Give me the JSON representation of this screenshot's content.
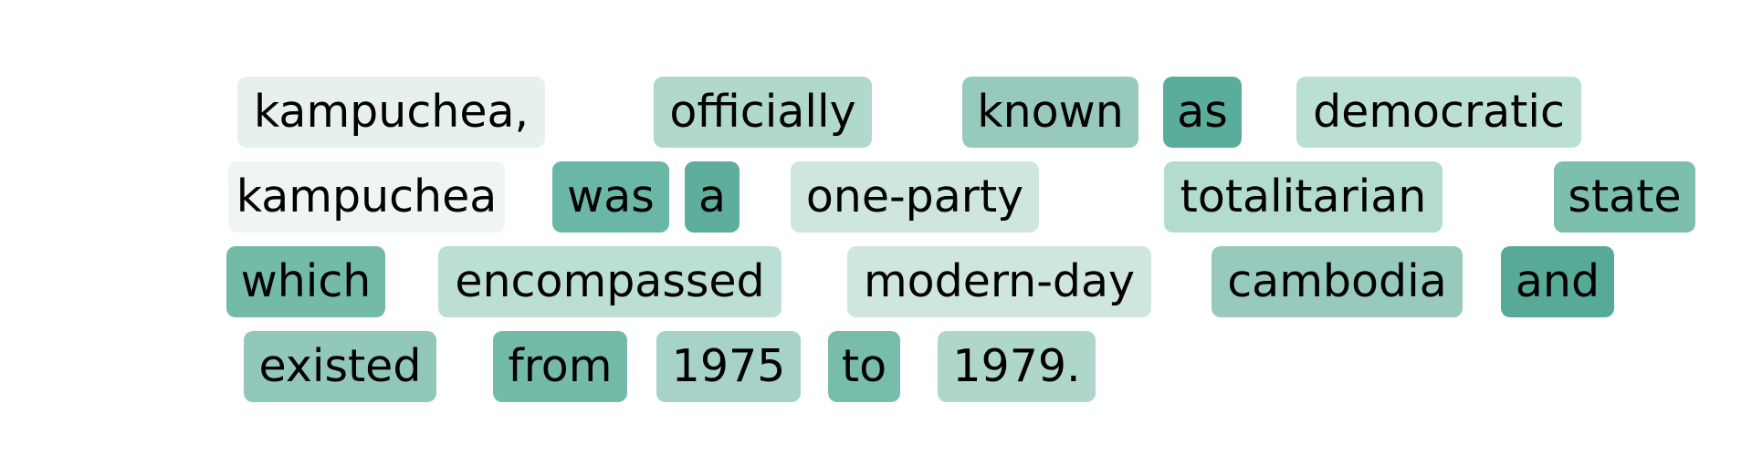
{
  "tokens": [
    {
      "text": "kampuchea,",
      "color": "#e6f0ed",
      "line": 0
    },
    {
      "text": "officially",
      "color": "#b0d8cd",
      "line": 0
    },
    {
      "text": "known",
      "color": "#97cabd",
      "line": 0
    },
    {
      "text": "as",
      "color": "#5bad9b",
      "line": 0
    },
    {
      "text": "democratic",
      "color": "#bcdfd5",
      "line": 0
    },
    {
      "text": "kampuchea",
      "color": "#eef5f2",
      "line": 1
    },
    {
      "text": "was",
      "color": "#6ab7a5",
      "line": 1
    },
    {
      "text": "a",
      "color": "#5fae9c",
      "line": 1
    },
    {
      "text": "one-party",
      "color": "#cfe5df",
      "line": 1
    },
    {
      "text": "totalitarian",
      "color": "#b4dbd0",
      "line": 1
    },
    {
      "text": "state",
      "color": "#7cbfaf",
      "line": 1
    },
    {
      "text": "which",
      "color": "#74baa9",
      "line": 2
    },
    {
      "text": "encompassed",
      "color": "#bcdfd5",
      "line": 2
    },
    {
      "text": "modern-day",
      "color": "#cfe5df",
      "line": 2
    },
    {
      "text": "cambodia",
      "color": "#97cabd",
      "line": 2
    },
    {
      "text": "and",
      "color": "#58aa98",
      "line": 2
    },
    {
      "text": "existed",
      "color": "#92c8ba",
      "line": 3
    },
    {
      "text": "from",
      "color": "#74baa9",
      "line": 3
    },
    {
      "text": "1975",
      "color": "#a6d2c7",
      "line": 3
    },
    {
      "text": "to",
      "color": "#78bdac",
      "line": 3
    },
    {
      "text": "1979.",
      "color": "#afd6cb",
      "line": 3
    }
  ]
}
